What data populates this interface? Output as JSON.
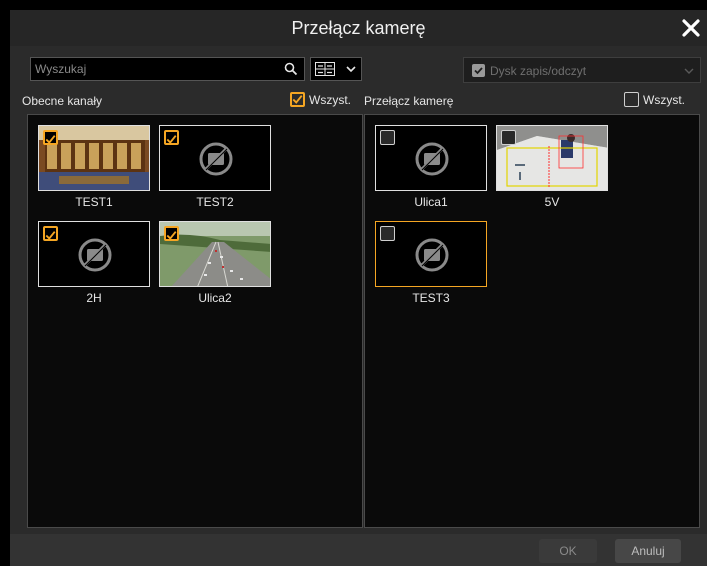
{
  "dialog": {
    "title": "Przełącz kamerę"
  },
  "toolbar": {
    "search_placeholder": "Wyszukaj",
    "disk_label": "Dysk zapis/odczyt"
  },
  "left": {
    "header": "Obecne kanały",
    "select_all_label": "Wszyst.",
    "select_all_checked": true,
    "channels": [
      {
        "name": "TEST1",
        "checked": true,
        "thumb": "library"
      },
      {
        "name": "TEST2",
        "checked": true,
        "thumb": "none"
      },
      {
        "name": "2H",
        "checked": true,
        "thumb": "none"
      },
      {
        "name": "Ulica2",
        "checked": true,
        "thumb": "highway"
      }
    ]
  },
  "right": {
    "header": "Przełącz kamerę",
    "select_all_label": "Wszyst.",
    "select_all_checked": false,
    "channels": [
      {
        "name": "Ulica1",
        "checked": false,
        "thumb": "none"
      },
      {
        "name": "5V",
        "checked": false,
        "thumb": "fisheye"
      },
      {
        "name": "TEST3",
        "checked": false,
        "thumb": "none",
        "selected": true
      }
    ]
  },
  "footer": {
    "ok_label": "OK",
    "cancel_label": "Anuluj"
  },
  "colors": {
    "accent": "#f5a623",
    "background": "#2b2b2b",
    "panel": "#0a0a0a"
  }
}
